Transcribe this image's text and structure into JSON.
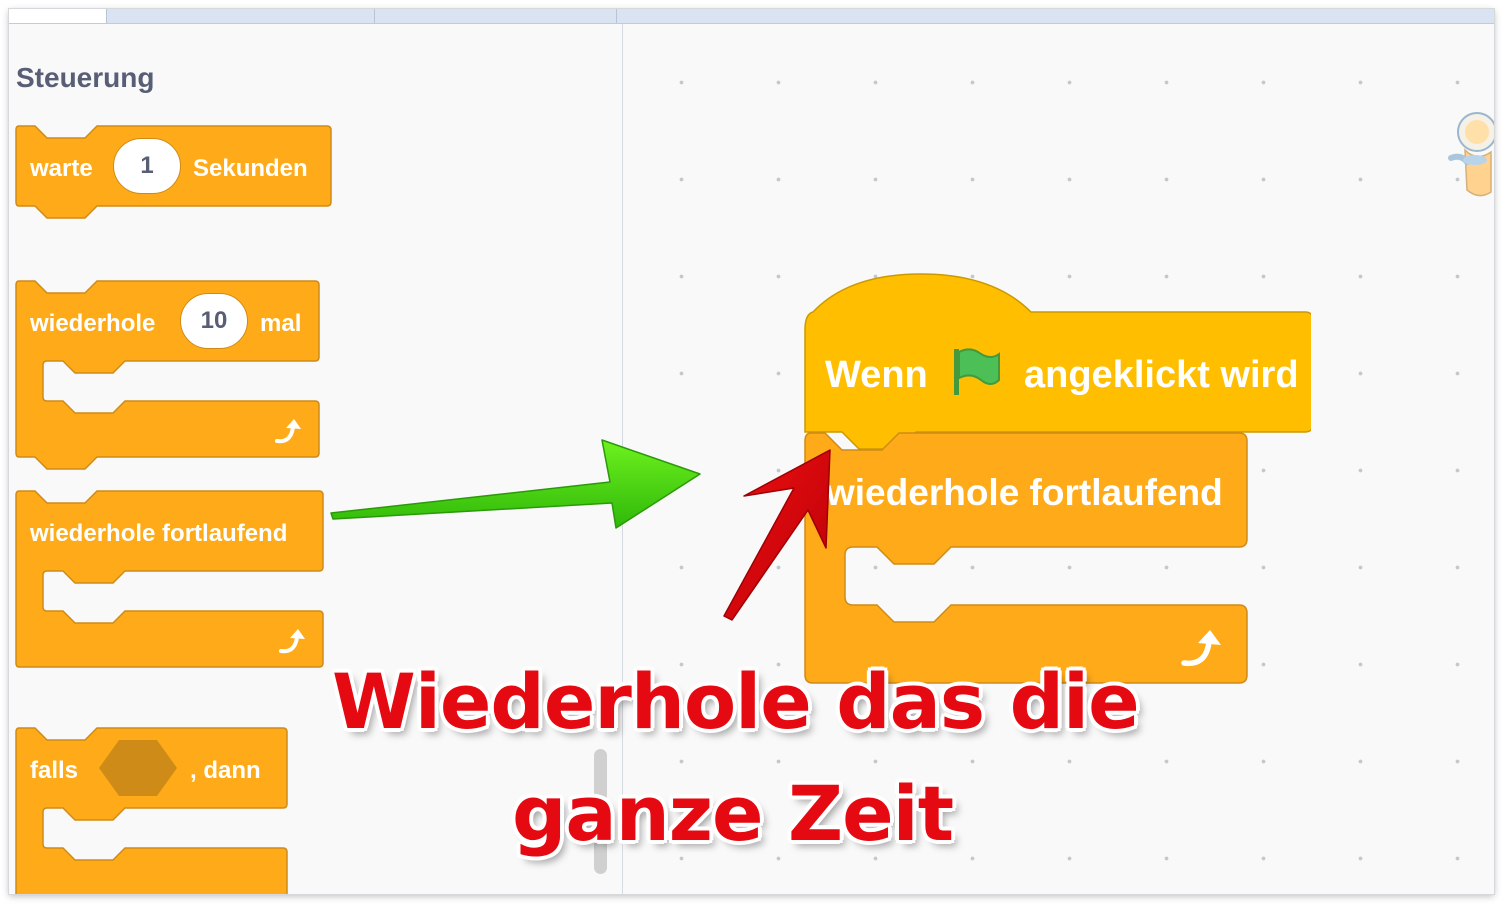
{
  "palette": {
    "category_title": "Steuerung",
    "blocks": {
      "wait": {
        "prefix": "warte",
        "value": "1",
        "suffix": "Sekunden"
      },
      "repeat": {
        "prefix": "wiederhole",
        "value": "10",
        "suffix": "mal"
      },
      "forever": {
        "label": "wiederhole fortlaufend"
      },
      "if": {
        "prefix": "falls",
        "suffix": ", dann"
      }
    }
  },
  "script": {
    "hat": {
      "prefix": "Wenn",
      "suffix": "angeklickt wird",
      "icon": "green-flag-icon"
    },
    "forever": {
      "label": "wiederhole fortlaufend"
    }
  },
  "annotation": {
    "line1": "Wiederhole das die",
    "line2": "ganze Zeit"
  },
  "colors": {
    "control_block": "#ffab19",
    "control_border": "#cf8b17",
    "event_block": "#ffbf00",
    "event_border": "#cc9900",
    "category_text": "#575e75",
    "annotation_red": "#e50912",
    "arrow_green": "#4fe10a",
    "arrow_red": "#e00a12"
  }
}
